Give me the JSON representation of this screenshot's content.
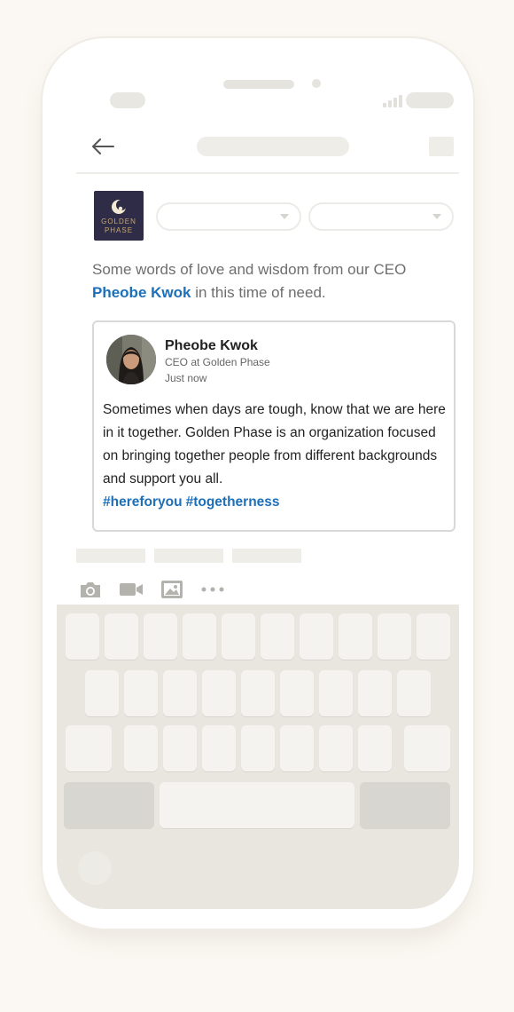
{
  "composer": {
    "company_logo_text": "GOLDEN\nPHASE",
    "intro_prefix": "Some words of love and wisdom from our CEO",
    "intro_mention": "Pheobe Kwok",
    "intro_suffix": "in this time of need."
  },
  "shared_post": {
    "author_name": "Pheobe Kwok",
    "author_title": "CEO at Golden Phase",
    "timestamp": "Just now",
    "body": "Sometimes when days are tough, know that we are here in it together. Golden Phase is an organization focused on bringing together people from different backgrounds and support you all.",
    "hashtags": [
      "#hereforyou",
      "#togetherness"
    ]
  },
  "toolbar": {
    "icons": [
      "camera-icon",
      "video-icon",
      "image-icon",
      "more-icon"
    ]
  },
  "colors": {
    "accent": "#1c6fb8",
    "logo_bg": "#2e2c46",
    "logo_gold": "#c9a86c",
    "keyboard_bg": "#e9e6e0"
  }
}
